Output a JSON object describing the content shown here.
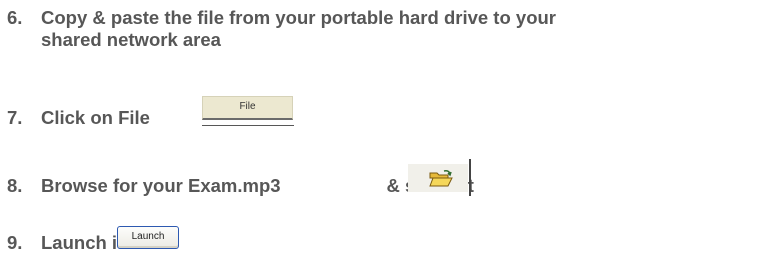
{
  "steps": [
    {
      "number": "6.",
      "line1": "Copy & paste the file from your portable hard drive to your",
      "line2": "shared network area"
    },
    {
      "number": "7.",
      "text": "Click on File",
      "file_button_label": "File"
    },
    {
      "number": "8.",
      "text_before": "Browse for your Exam.mp3",
      "text_after": "& select it",
      "icon": "open-folder-icon"
    },
    {
      "number": "9.",
      "text": "Launch it",
      "launch_button_label": "Launch"
    }
  ],
  "colors": {
    "text": "#575757",
    "file_menu_bg": "#ece8d0",
    "launch_border": "#2d59b1",
    "folder_yellow": "#f5d75a"
  }
}
